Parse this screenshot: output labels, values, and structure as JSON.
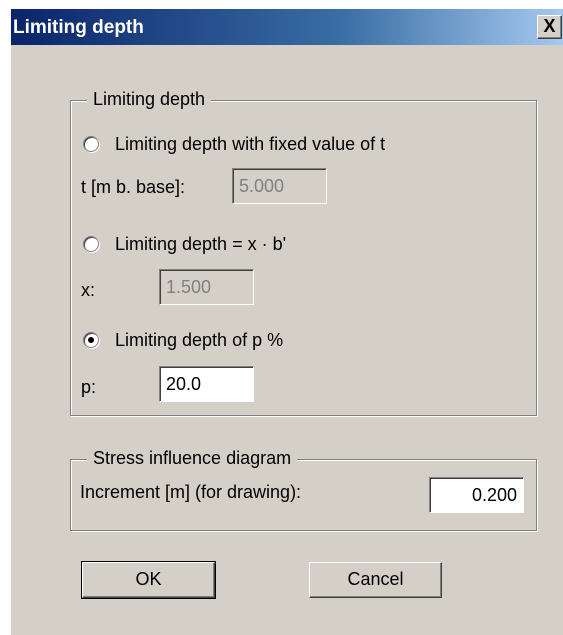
{
  "window": {
    "title": "Limiting depth",
    "close_glyph": "X"
  },
  "limiting_group": {
    "legend": "Limiting depth",
    "option1": {
      "label": "Limiting depth with fixed value of t",
      "checked": false,
      "field_label": "t [m b. base]:",
      "field_value": "5.000",
      "field_enabled": false
    },
    "option2": {
      "label": "Limiting depth = x · b'",
      "checked": false,
      "field_label": "x:",
      "field_value": "1.500",
      "field_enabled": false
    },
    "option3": {
      "label": "Limiting depth of p %",
      "checked": true,
      "field_label": "p:",
      "field_value": "20.0",
      "field_enabled": true
    }
  },
  "stress_group": {
    "legend": "Stress influence diagram",
    "increment_label": "Increment [m] (for drawing):",
    "increment_value": "0.200"
  },
  "buttons": {
    "ok": "OK",
    "cancel": "Cancel"
  },
  "colors": {
    "dialog_background": "#d4d0c8",
    "title_gradient_start": "#0a246a",
    "title_gradient_end": "#a6caf0",
    "disabled_text": "#808080"
  }
}
